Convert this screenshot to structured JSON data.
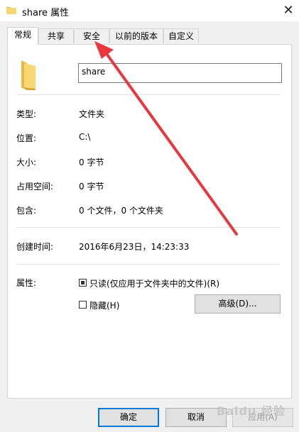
{
  "window": {
    "title": "share 属性",
    "close_glyph": "✕"
  },
  "tabs": [
    {
      "label": "常规",
      "active": true
    },
    {
      "label": "共享",
      "active": false
    },
    {
      "label": "安全",
      "active": false
    },
    {
      "label": "以前的版本",
      "active": false
    },
    {
      "label": "自定义",
      "active": false
    }
  ],
  "general": {
    "folder_name": "share",
    "rows": [
      {
        "label": "类型:",
        "value": "文件夹"
      },
      {
        "label": "位置:",
        "value": "C:\\"
      },
      {
        "label": "大小:",
        "value": "0 字节"
      },
      {
        "label": "占用空间:",
        "value": "0 字节"
      },
      {
        "label": "包含:",
        "value": "0 个文件，0 个文件夹"
      }
    ],
    "created": {
      "label": "创建时间:",
      "value": "2016年6月23日，14:23:33"
    },
    "attributes": {
      "label": "属性:",
      "readonly": {
        "label": "只读(仅应用于文件夹中的文件)(R)",
        "checked": true
      },
      "hidden": {
        "label": "隐藏(H)",
        "checked": false
      },
      "advanced_button": "高级(D)..."
    }
  },
  "footer": {
    "ok": "确定",
    "cancel": "取消",
    "apply": "应用(A)"
  },
  "watermark": "Baidu 经验",
  "colors": {
    "folder": "#f8d775",
    "folder_shade": "#e8b84a",
    "annotation_arrow": "#e8383d",
    "accent": "#0078d7"
  },
  "icons": {
    "title": "folder-icon",
    "large": "folder-icon",
    "close": "close-icon"
  }
}
